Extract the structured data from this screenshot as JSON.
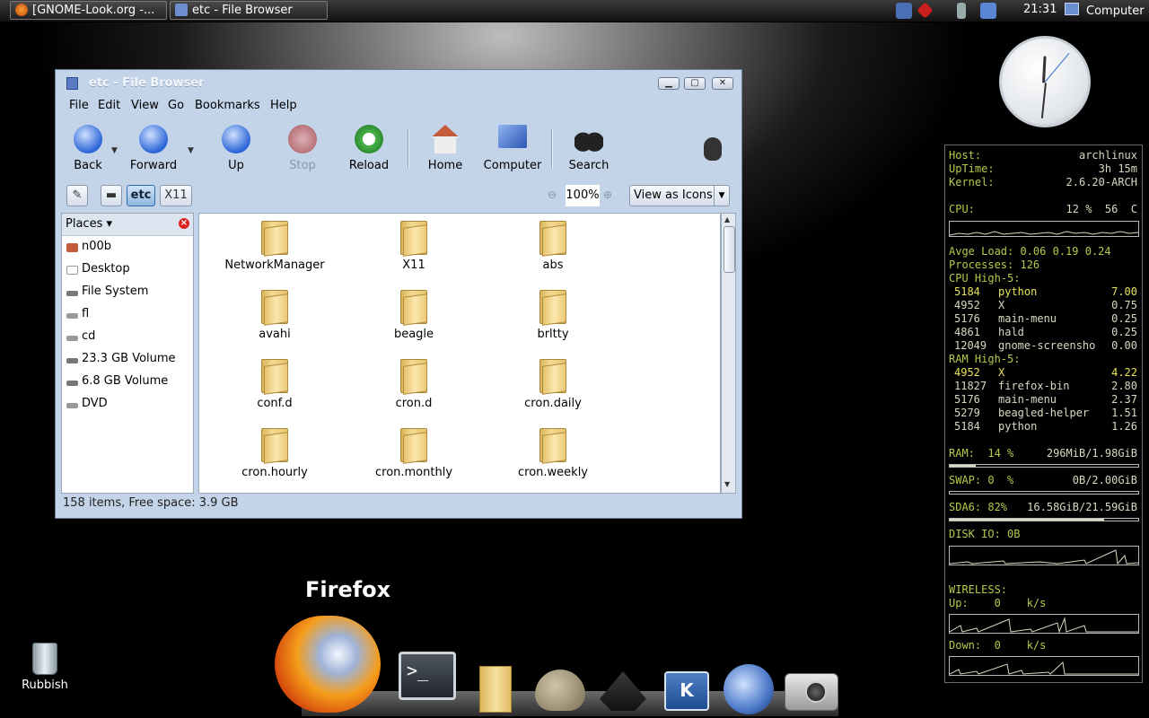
{
  "panel": {
    "tasks": [
      {
        "label": "[GNOME-Look.org -...",
        "icon": "firefox-icon"
      },
      {
        "label": "etc - File Browser",
        "icon": "folder-icon"
      }
    ],
    "clock": "21:31",
    "computer_menu": "Computer"
  },
  "window": {
    "title": "etc - File Browser",
    "menu": [
      "File",
      "Edit",
      "View",
      "Go",
      "Bookmarks",
      "Help"
    ],
    "toolbar": {
      "back": "Back",
      "forward": "Forward",
      "up": "Up",
      "stop": "Stop",
      "reload": "Reload",
      "home": "Home",
      "computer": "Computer",
      "search": "Search"
    },
    "location": {
      "path_buttons": [
        "etc",
        "X11"
      ],
      "zoom": "100%",
      "view_mode": "View as Icons"
    },
    "sidebar": {
      "title": "Places",
      "items": [
        "n00b",
        "Desktop",
        "File System",
        "fl",
        "cd",
        "23.3 GB Volume",
        "6.8 GB Volume",
        "DVD"
      ]
    },
    "files": [
      "NetworkManager",
      "X11",
      "abs",
      "avahi",
      "beagle",
      "brltty",
      "conf.d",
      "cron.d",
      "cron.daily",
      "cron.hourly",
      "cron.monthly",
      "cron.weekly"
    ],
    "status": "158 items, Free space: 3.9 GB"
  },
  "conky": {
    "host_label": "Host:",
    "host": "archlinux",
    "uptime_label": "UpTime:",
    "uptime": "3h 15m",
    "kernel_label": "Kernel:",
    "kernel": "2.6.20-ARCH",
    "cpu_label": "CPU:",
    "cpu": "12 %  56  C",
    "load": "Avge Load: 0.06 0.19 0.24",
    "processes": "Processes: 126",
    "cpu_high_title": "CPU High-5:",
    "cpu_high": [
      {
        "pid": "5184",
        "name": "python",
        "val": "7.00"
      },
      {
        "pid": "4952",
        "name": "X",
        "val": "0.75"
      },
      {
        "pid": "5176",
        "name": "main-menu",
        "val": "0.25"
      },
      {
        "pid": "4861",
        "name": "hald",
        "val": "0.25"
      },
      {
        "pid": "12049",
        "name": "gnome-screensho",
        "val": "0.00"
      }
    ],
    "ram_high_title": "RAM High-5:",
    "ram_high": [
      {
        "pid": "4952",
        "name": "X",
        "val": "4.22"
      },
      {
        "pid": "11827",
        "name": "firefox-bin",
        "val": "2.80"
      },
      {
        "pid": "5176",
        "name": "main-menu",
        "val": "2.37"
      },
      {
        "pid": "5279",
        "name": "beagled-helper",
        "val": "1.51"
      },
      {
        "pid": "5184",
        "name": "python",
        "val": "1.26"
      }
    ],
    "ram": {
      "label": "RAM:  14 %",
      "value": "296MiB/1.98GiB",
      "fraction": 0.14
    },
    "swap": {
      "label": "SWAP: 0  %",
      "value": "0B/2.00GiB",
      "fraction": 0.0
    },
    "disk": {
      "label": "SDA6: 82%",
      "value": "16.58GiB/21.59GiB",
      "fraction": 0.82
    },
    "disk_io": "DISK IO: 0B",
    "wireless_title": "WIRELESS:",
    "up": "Up:    0    k/s",
    "down": "Down:  0    k/s",
    "colors": {
      "label": "#b8c84a",
      "highlight": "#e8e25a",
      "text": "#d9d9c2"
    }
  },
  "desktop": {
    "trash": "Rubbish",
    "dock_label": "Firefox",
    "dock_items": [
      "firefox-icon",
      "terminal-icon",
      "folder-icon",
      "gimp-icon",
      "inkscape-icon",
      "kde-icon",
      "wolf-icon",
      "camera-icon"
    ]
  }
}
